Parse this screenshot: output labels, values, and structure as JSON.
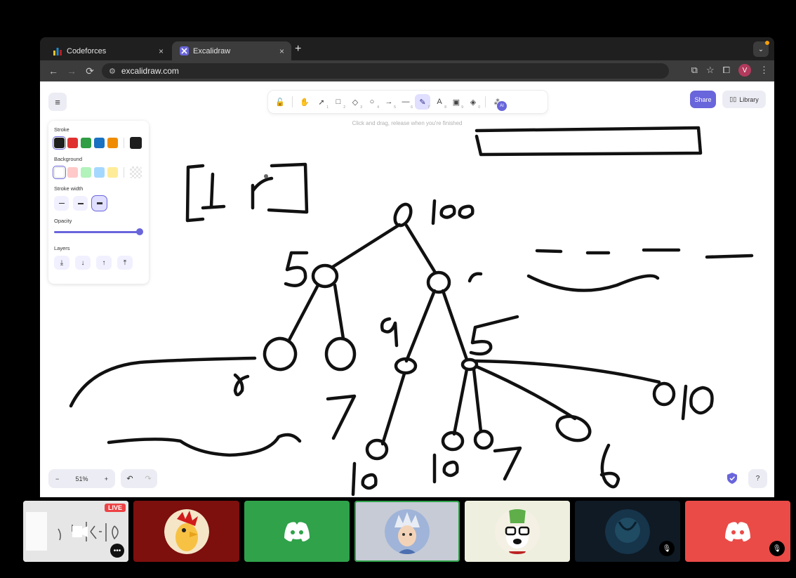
{
  "browser": {
    "tabs": [
      {
        "title": "Codeforces",
        "icon": "codeforces-icon",
        "active": false
      },
      {
        "title": "Excalidraw",
        "icon": "excalidraw-icon",
        "active": true
      }
    ],
    "close_glyph": "×",
    "new_tab_glyph": "+",
    "url": "excalidraw.com",
    "profile_initial": "V"
  },
  "excalidraw": {
    "hint": "Click and drag, release when you're finished",
    "share_label": "Share",
    "library_label": "Library",
    "tools": [
      {
        "name": "lock-icon",
        "glyph": "🔓",
        "key": ""
      },
      {
        "name": "hand-icon",
        "glyph": "✋",
        "key": ""
      },
      {
        "name": "selection-icon",
        "glyph": "➚",
        "key": "1"
      },
      {
        "name": "rectangle-icon",
        "glyph": "□",
        "key": "2"
      },
      {
        "name": "diamond-icon",
        "glyph": "◇",
        "key": "3"
      },
      {
        "name": "ellipse-icon",
        "glyph": "○",
        "key": "4"
      },
      {
        "name": "arrow-icon",
        "glyph": "→",
        "key": "5"
      },
      {
        "name": "line-icon",
        "glyph": "—",
        "key": "6"
      },
      {
        "name": "pencil-icon",
        "glyph": "✎",
        "key": "7",
        "active": true
      },
      {
        "name": "text-icon",
        "glyph": "A",
        "key": "8"
      },
      {
        "name": "image-icon",
        "glyph": "▣",
        "key": "9"
      },
      {
        "name": "eraser-icon",
        "glyph": "◈",
        "key": "0"
      }
    ],
    "ai_badge": "AI",
    "properties": {
      "stroke_label": "Stroke",
      "stroke_colors": [
        "#1e1e1e",
        "#e03131",
        "#2f9e44",
        "#1971c2",
        "#f08c00"
      ],
      "stroke_current": "#1e1e1e",
      "background_label": "Background",
      "background_colors": [
        "transparent",
        "#ffc9c9",
        "#b2f2bb",
        "#a5d8ff",
        "#ffec99"
      ],
      "stroke_width_label": "Stroke width",
      "opacity_label": "Opacity",
      "opacity_value": 100,
      "layers_label": "Layers",
      "layer_buttons": [
        "⤓",
        "↓",
        "↑",
        "⤒"
      ]
    },
    "zoom": {
      "minus": "−",
      "value": "51%",
      "plus": "+"
    },
    "undo_glyph": "↶",
    "redo_glyph": "↷",
    "help_glyph": "?"
  },
  "drawing_text": {
    "root": "100",
    "left_child": "5",
    "right_child": "5",
    "mid_label": "9",
    "leaf_7": "7",
    "leaf_10a": "10",
    "leaf_10b": "10",
    "leaf_7b": "7",
    "leaf_6": "6",
    "leaf_010": "010"
  },
  "call": {
    "live_label": "LIVE",
    "dots_glyph": "•••",
    "mute_glyph": "🎙",
    "tile_colors": [
      "#7d0f0d",
      "#2fa24a",
      "#c7cbd6",
      "#efefdf",
      "#0f1a24",
      "#ea4b47"
    ]
  }
}
